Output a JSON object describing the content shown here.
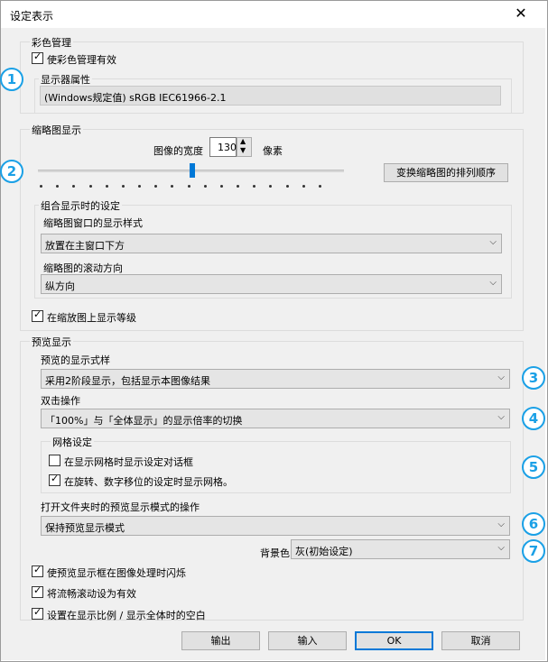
{
  "window": {
    "title": "设定表示",
    "close_glyph": "✕"
  },
  "color_management": {
    "group_title": "彩色管理",
    "enable_label": "使彩色管理有效",
    "display_attr_title": "显示器属性",
    "display_attr_value": "(Windows规定值) sRGB IEC61966-2.1"
  },
  "thumbnail": {
    "group_title": "缩略图显示",
    "width_label": "图像的宽度",
    "width_value": "130",
    "unit": "像素",
    "sort_button": "变换缩略图的排列顺序",
    "combo_group_title": "组合显示时的设定",
    "window_style_label": "缩略图窗口的显示样式",
    "window_style_value": "放置在主窗口下方",
    "scroll_dir_label": "缩略图的滚动方向",
    "scroll_dir_value": "纵方向",
    "show_rating_label": "在缩放图上显示等级"
  },
  "preview": {
    "group_title": "预览显示",
    "display_style_label": "预览的显示式样",
    "display_style_value": "采用2阶段显示，包括显示本图像结果",
    "dblclick_label": "双击操作",
    "dblclick_value": "「100%」与「全体显示」的显示倍率的切换",
    "grid_title": "网格设定",
    "grid_opt1": "在显示网格时显示设定对话框",
    "grid_opt2": "在旋转、数字移位的设定时显示网格。",
    "folder_label": "打开文件夹时的预览显示模式的操作",
    "folder_value": "保持预览显示模式",
    "bg_label": "背景色",
    "bg_value": "灰(初始设定)"
  },
  "bottom_options": {
    "opt1": "使预览显示框在图像处理时闪烁",
    "opt2": "将流畅滚动设为有效",
    "opt3": "设置在显示比例 / 显示全体时的空白"
  },
  "buttons": {
    "export": "输出",
    "import": "输入",
    "ok": "OK",
    "cancel": "取消"
  },
  "callouts": [
    "1",
    "2",
    "3",
    "4",
    "5",
    "6",
    "7"
  ],
  "slider_level": 0.5,
  "accent_color": "#1aa0e6",
  "focus_color": "#0078d7"
}
